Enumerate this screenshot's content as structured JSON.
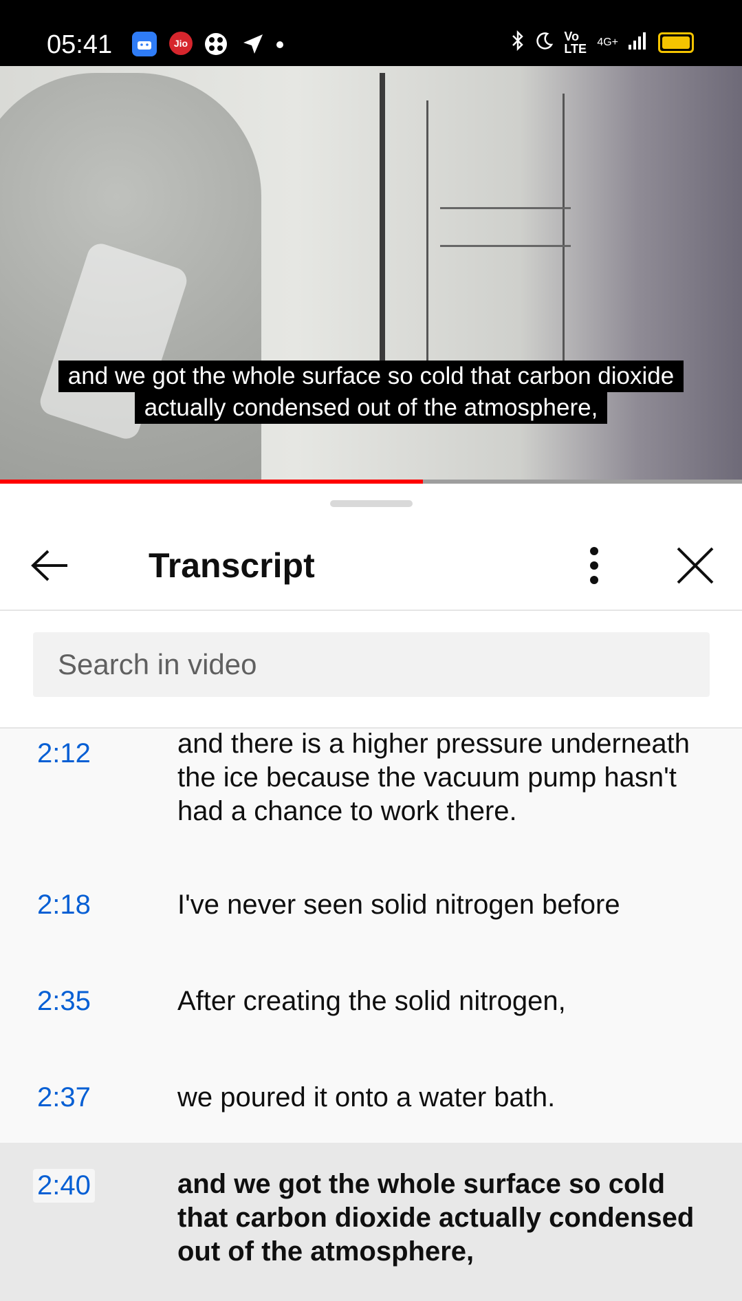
{
  "status_bar": {
    "time": "05:41",
    "jio_label": "Jio",
    "network_label": "Vo LTE",
    "signal_label": "4G+",
    "icons": [
      "app-icon",
      "jio-icon",
      "game-icon",
      "navigation-icon",
      "notification-dot-icon",
      "bluetooth-icon",
      "moon-icon",
      "signal-icon",
      "battery-icon"
    ]
  },
  "video": {
    "caption_line_1": "and we got the whole surface so cold that carbon dioxide",
    "caption_line_2": "actually condensed out of the atmosphere,",
    "progress_fraction": 0.57
  },
  "panel": {
    "title": "Transcript",
    "search_placeholder": "Search in video",
    "icons": [
      "back-arrow-icon",
      "more-vertical-icon",
      "close-icon"
    ]
  },
  "transcript": [
    {
      "time": "2:12",
      "text": "and there is a higher pressure underneath the ice because the vacuum pump hasn't had a chance to work there.",
      "active": false
    },
    {
      "time": "2:18",
      "text": "I've never seen solid nitrogen before",
      "active": false
    },
    {
      "time": "2:35",
      "text": "After creating the solid nitrogen,",
      "active": false
    },
    {
      "time": "2:37",
      "text": "we poured it onto a water bath.",
      "active": false
    },
    {
      "time": "2:40",
      "text": "and we got the whole surface so cold that carbon dioxide actually condensed out of the atmosphere,",
      "active": true
    }
  ],
  "colors": {
    "accent": "#065fd4",
    "progress": "#ff0000",
    "active_row": "#e8e8e8"
  }
}
